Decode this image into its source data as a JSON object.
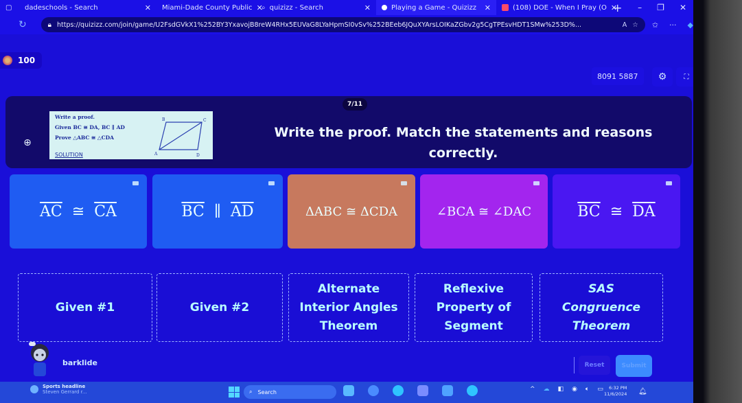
{
  "browser": {
    "tabs": [
      {
        "title": "dadeschools - Search",
        "active": false
      },
      {
        "title": "Miami-Dade County Public",
        "active": false
      },
      {
        "title": "quizizz - Search",
        "active": false
      },
      {
        "title": "Playing a Game - Quizizz",
        "active": true
      },
      {
        "title": "(108) DOE - When I Pray (O",
        "active": false
      }
    ],
    "new_tab": "+",
    "url": "https://quizizz.com/join/game/U2FsdGVkX1%252BY3YxavojB8reW4RHx5EUVaG8LYaHpmSI0vSv%252BEeb6JQuXYArsLOIKaZGbv2g5CgTPEsvHDT1SMw%253D%..."
  },
  "quiz": {
    "score": "100",
    "game_code": "8091 5887",
    "counter": "7/11",
    "question": "Write the proof. Match the statements and reasons correctly.",
    "image": {
      "line1": "Write a proof.",
      "given": "Given  BC ≅ DA, BC ∥ AD",
      "prove": "Prove  △ABC ≅ △CDA",
      "solution": "SOLUTION",
      "vertices": [
        "A",
        "B",
        "C",
        "D"
      ]
    },
    "statements": [
      {
        "a": "AC",
        "op": "≅",
        "b": "CA",
        "color": "#1f5cf2"
      },
      {
        "a": "BC",
        "op": "∥",
        "b": "AD",
        "color": "#1f5cf2"
      },
      {
        "a": "ΔABC",
        "op": "≅",
        "b": "ΔCDA",
        "color": "#c7795e"
      },
      {
        "a": "∠BCA",
        "op": "≅",
        "b": "∠DAC",
        "color": "#a325ee"
      },
      {
        "a": "BC",
        "op": "≅",
        "b": "DA",
        "color": "#4a17f2"
      }
    ],
    "reasons": [
      {
        "label": "Given #1"
      },
      {
        "label": "Given #2"
      },
      {
        "label": "Alternate Interior Angles Theorem"
      },
      {
        "label": "Reflexive Property of Segment"
      },
      {
        "label": "SAS Congruence Theorem"
      }
    ],
    "username": "barklide",
    "reset_label": "Reset",
    "submit_label": "Submit"
  },
  "taskbar": {
    "news_title": "Sports headline",
    "news_sub": "Steven Gerrard r...",
    "search_label": "Search",
    "time": "6:32 PM",
    "date": "11/6/2024"
  }
}
